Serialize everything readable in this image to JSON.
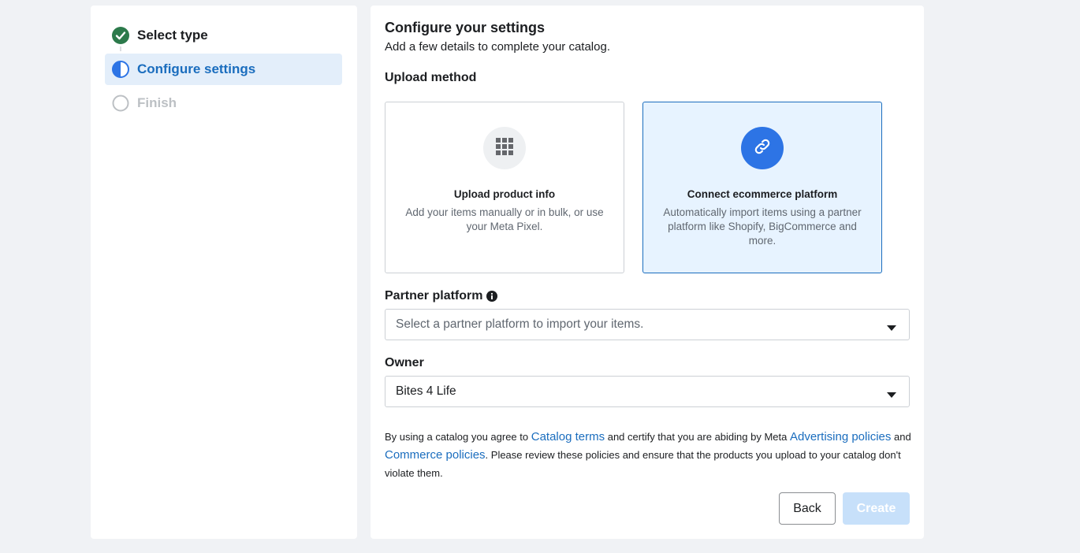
{
  "steps": [
    {
      "label": "Select type",
      "state": "complete",
      "icon": "check-circle-icon"
    },
    {
      "label": "Configure settings",
      "state": "active",
      "icon": "half-circle-icon"
    },
    {
      "label": "Finish",
      "state": "pending",
      "icon": "empty-circle-icon"
    }
  ],
  "main": {
    "title": "Configure your settings",
    "subtitle": "Add a few details to complete your catalog.",
    "upload_label": "Upload method",
    "cards": [
      {
        "title": "Upload product info",
        "desc": "Add your items manually or in bulk, or use your Meta Pixel.",
        "icon": "grid-icon",
        "selected": false
      },
      {
        "title": "Connect ecommerce platform",
        "desc": "Automatically import items using a partner platform like Shopify, BigCommerce and more.",
        "icon": "link-icon",
        "selected": true
      }
    ],
    "partner_label": "Partner platform",
    "partner_placeholder": "Select a partner platform to import your items.",
    "owner_label": "Owner",
    "owner_value": "Bites 4 Life",
    "terms": {
      "t1": "By using a catalog you agree to ",
      "link_catalog_terms": "Catalog terms",
      "t2": " and certify that you are abiding by Meta ",
      "link_advertising": "Advertising policies",
      "t3": " and ",
      "link_commerce": "Commerce policies",
      "t4": ". Please review these policies and ensure that the products you upload to your catalog don't violate them."
    },
    "back_label": "Back",
    "create_label": "Create"
  },
  "colors": {
    "accent": "#1a6dbe",
    "success": "#31a24c",
    "selected_bg": "#e7f3ff",
    "disabled_btn": "#c7e0fa"
  }
}
